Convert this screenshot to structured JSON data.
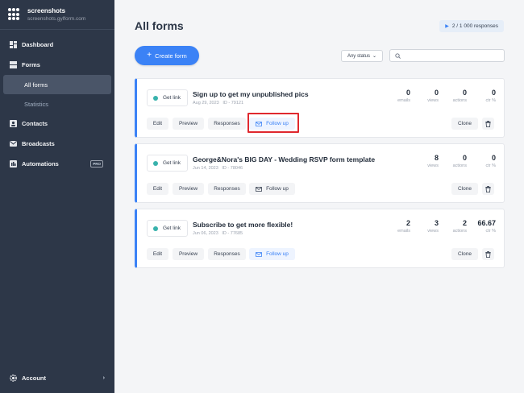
{
  "brand": {
    "title": "screenshots",
    "subtitle": "screenshots.gylform.com"
  },
  "nav": {
    "dashboard": "Dashboard",
    "forms": "Forms",
    "all_forms": "All forms",
    "statistics": "Statistics",
    "contacts": "Contacts",
    "broadcasts": "Broadcasts",
    "automations": "Automations",
    "pro_badge": "PRO",
    "account": "Account"
  },
  "header": {
    "title": "All forms",
    "responses": "2 / 1 000 responses",
    "create_label": "Create form",
    "status_filter": "Any status",
    "search_placeholder": ""
  },
  "card_buttons": {
    "get_link": "Get link",
    "edit": "Edit",
    "preview": "Preview",
    "responses": "Responses",
    "follow_up": "Follow up",
    "clone": "Clone"
  },
  "stat_labels": {
    "emails": "emails",
    "views": "views",
    "actions": "actions",
    "ctr": "ctr %"
  },
  "forms": [
    {
      "title": "Sign up to get my unpublished pics",
      "date": "Aug 29, 2023",
      "id": "ID - 79121",
      "emails": "0",
      "views": "0",
      "actions": "0",
      "ctr": "0"
    },
    {
      "title": "George&Nora's BIG DAY - Wedding RSVP form template",
      "date": "Jun 14, 2023",
      "id": "ID - 78046",
      "emails": "",
      "views": "8",
      "actions": "0",
      "ctr": "0"
    },
    {
      "title": "Subscribe to get more flexible!",
      "date": "Jun 06, 2023",
      "id": "ID - 77685",
      "emails": "2",
      "views": "3",
      "actions": "2",
      "ctr": "66.67"
    }
  ],
  "colors": {
    "accent": "#3b82f6",
    "sidebar": "#2d3748",
    "highlight": "#e0282e",
    "link_dot": "#38b2ac"
  }
}
